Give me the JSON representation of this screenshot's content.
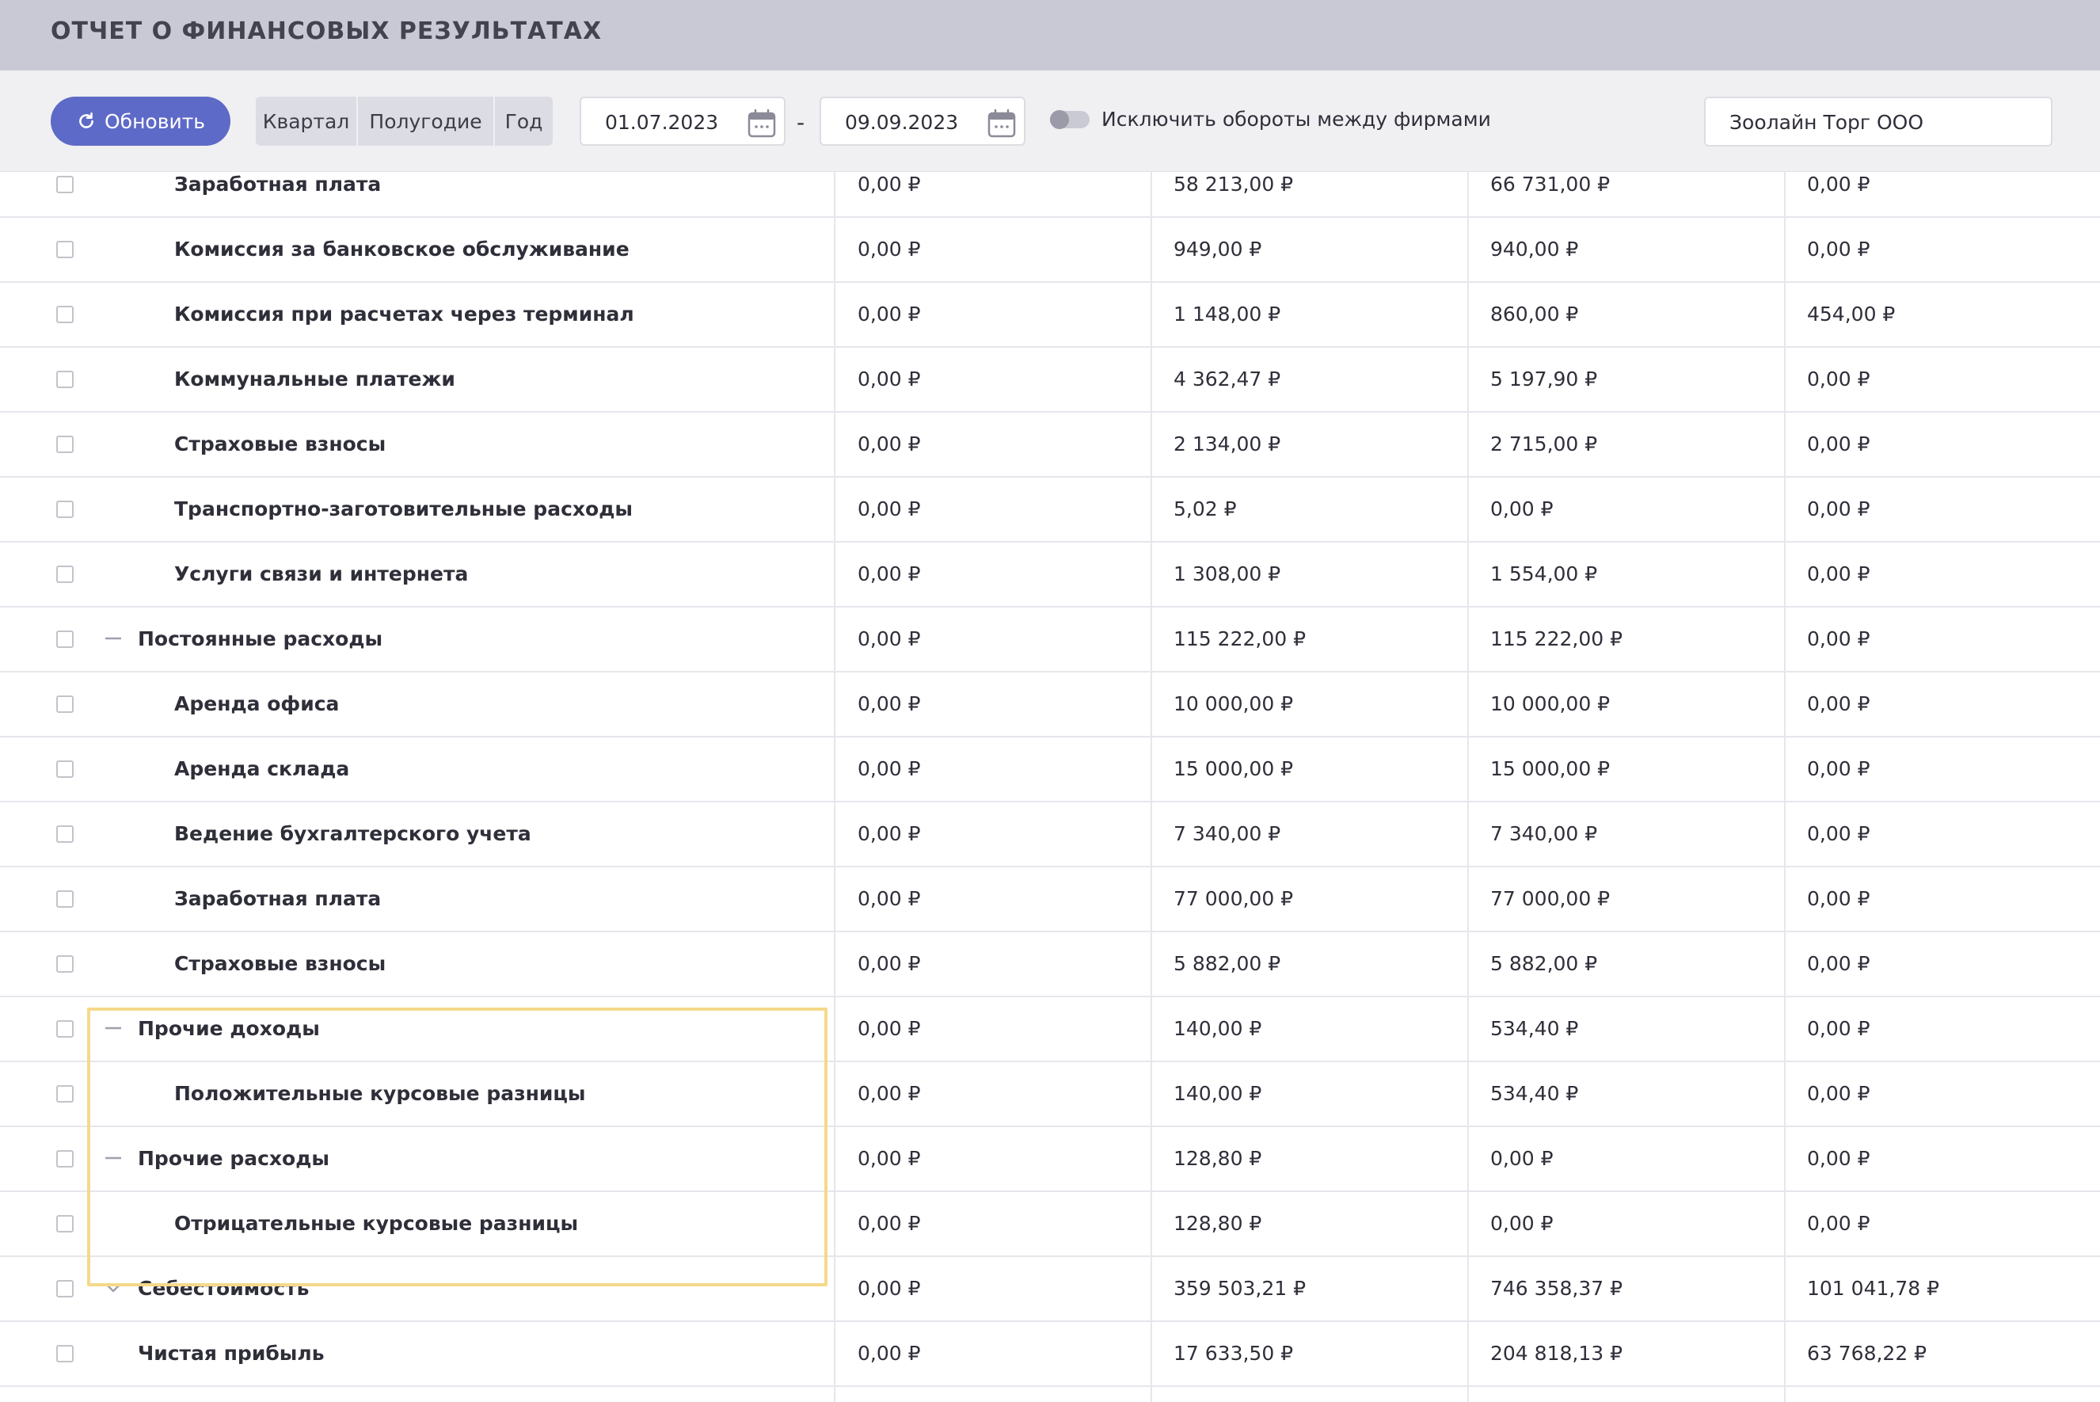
{
  "header": {
    "title": "ОТЧЕТ О ФИНАНСОВЫХ РЕЗУЛЬТАТАХ"
  },
  "toolbar": {
    "refresh_label": "Обновить",
    "periods": [
      "Квартал",
      "Полугодие",
      "Год"
    ],
    "date_from": "01.07.2023",
    "date_separator": "-",
    "date_to": "09.09.2023",
    "exclude_label": "Исключить обороты между фирмами",
    "exclude_enabled": false,
    "company": "Зоолайн Торг ООО"
  },
  "colors": {
    "accent": "#5e6ac7",
    "header_bg": "#c9c9d6",
    "highlight": "#f5d98a"
  },
  "table": {
    "rows": [
      {
        "label": "Заработная плата",
        "level": 2,
        "expander": "",
        "v": [
          "0,00 ₽",
          "58 213,00 ₽",
          "66 731,00 ₽",
          "0,00 ₽"
        ]
      },
      {
        "label": "Комиссия за банковское обслуживание",
        "level": 2,
        "expander": "",
        "v": [
          "0,00 ₽",
          "949,00 ₽",
          "940,00 ₽",
          "0,00 ₽"
        ]
      },
      {
        "label": "Комиссия при расчетах через терминал",
        "level": 2,
        "expander": "",
        "v": [
          "0,00 ₽",
          "1 148,00 ₽",
          "860,00 ₽",
          "454,00 ₽"
        ]
      },
      {
        "label": "Коммунальные платежи",
        "level": 2,
        "expander": "",
        "v": [
          "0,00 ₽",
          "4 362,47 ₽",
          "5 197,90 ₽",
          "0,00 ₽"
        ]
      },
      {
        "label": "Страховые взносы",
        "level": 2,
        "expander": "",
        "v": [
          "0,00 ₽",
          "2 134,00 ₽",
          "2 715,00 ₽",
          "0,00 ₽"
        ]
      },
      {
        "label": "Транспортно-заготовительные расходы",
        "level": 2,
        "expander": "",
        "v": [
          "0,00 ₽",
          "5,02 ₽",
          "0,00 ₽",
          "0,00 ₽"
        ]
      },
      {
        "label": "Услуги связи и интернета",
        "level": 2,
        "expander": "",
        "v": [
          "0,00 ₽",
          "1 308,00 ₽",
          "1 554,00 ₽",
          "0,00 ₽"
        ]
      },
      {
        "label": "Постоянные расходы",
        "level": 1,
        "expander": "collapse",
        "v": [
          "0,00 ₽",
          "115 222,00 ₽",
          "115 222,00 ₽",
          "0,00 ₽"
        ]
      },
      {
        "label": "Аренда офиса",
        "level": 2,
        "expander": "",
        "v": [
          "0,00 ₽",
          "10 000,00 ₽",
          "10 000,00 ₽",
          "0,00 ₽"
        ]
      },
      {
        "label": "Аренда склада",
        "level": 2,
        "expander": "",
        "v": [
          "0,00 ₽",
          "15 000,00 ₽",
          "15 000,00 ₽",
          "0,00 ₽"
        ]
      },
      {
        "label": "Ведение бухгалтерского учета",
        "level": 2,
        "expander": "",
        "v": [
          "0,00 ₽",
          "7 340,00 ₽",
          "7 340,00 ₽",
          "0,00 ₽"
        ]
      },
      {
        "label": "Заработная плата",
        "level": 2,
        "expander": "",
        "v": [
          "0,00 ₽",
          "77 000,00 ₽",
          "77 000,00 ₽",
          "0,00 ₽"
        ]
      },
      {
        "label": "Страховые взносы",
        "level": 2,
        "expander": "",
        "v": [
          "0,00 ₽",
          "5 882,00 ₽",
          "5 882,00 ₽",
          "0,00 ₽"
        ]
      },
      {
        "label": "Прочие доходы",
        "level": 1,
        "expander": "collapse",
        "v": [
          "0,00 ₽",
          "140,00 ₽",
          "534,40 ₽",
          "0,00 ₽"
        ]
      },
      {
        "label": "Положительные курсовые разницы",
        "level": 2,
        "expander": "",
        "v": [
          "0,00 ₽",
          "140,00 ₽",
          "534,40 ₽",
          "0,00 ₽"
        ]
      },
      {
        "label": "Прочие расходы",
        "level": 1,
        "expander": "collapse",
        "v": [
          "0,00 ₽",
          "128,80 ₽",
          "0,00 ₽",
          "0,00 ₽"
        ]
      },
      {
        "label": "Отрицательные курсовые разницы",
        "level": 2,
        "expander": "",
        "v": [
          "0,00 ₽",
          "128,80 ₽",
          "0,00 ₽",
          "0,00 ₽"
        ]
      },
      {
        "label": "Себестоимость",
        "level": 1,
        "expander": "expand",
        "v": [
          "0,00 ₽",
          "359 503,21 ₽",
          "746 358,37 ₽",
          "101 041,78 ₽"
        ]
      },
      {
        "label": "Чистая прибыль",
        "level": 1,
        "expander": "",
        "v": [
          "0,00 ₽",
          "17 633,50 ₽",
          "204 818,13 ₽",
          "63 768,22 ₽"
        ]
      }
    ]
  }
}
